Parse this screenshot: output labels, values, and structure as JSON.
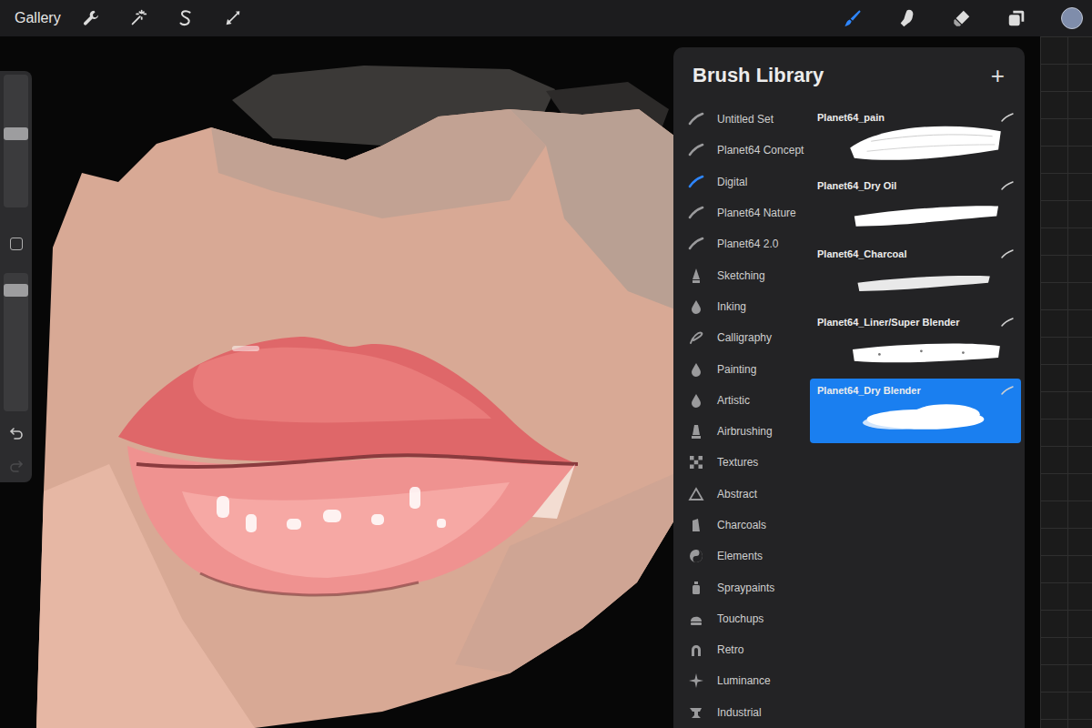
{
  "toolbar": {
    "gallery": "Gallery",
    "actions": [
      {
        "kind": "wrench"
      },
      {
        "kind": "wand"
      },
      {
        "kind": "selection"
      },
      {
        "kind": "transform"
      }
    ],
    "tools": [
      {
        "kind": "brush",
        "selected": true
      },
      {
        "kind": "smudge",
        "selected": false
      },
      {
        "kind": "eraser",
        "selected": false
      },
      {
        "kind": "layers",
        "selected": false
      }
    ],
    "color": "#7f8dab"
  },
  "sidebar": {
    "size_level": 0.56,
    "opacity_level": 0.91
  },
  "brush_library": {
    "title": "Brush Library",
    "add": "+",
    "sets": [
      {
        "label": "Untitled Set",
        "kind": "stroke",
        "selected": false
      },
      {
        "label": "Planet64 Concept",
        "kind": "stroke",
        "selected": false
      },
      {
        "label": "Digital",
        "kind": "stroke",
        "selected": true
      },
      {
        "label": "Planet64 Nature",
        "kind": "stroke",
        "selected": false
      },
      {
        "label": "Planet64 2.0",
        "kind": "stroke",
        "selected": false
      },
      {
        "label": "Sketching",
        "kind": "pencil",
        "selected": false
      },
      {
        "label": "Inking",
        "kind": "drop",
        "selected": false
      },
      {
        "label": "Calligraphy",
        "kind": "curl",
        "selected": false
      },
      {
        "label": "Painting",
        "kind": "drop",
        "selected": false
      },
      {
        "label": "Artistic",
        "kind": "drop",
        "selected": false
      },
      {
        "label": "Airbrushing",
        "kind": "airbrush",
        "selected": false
      },
      {
        "label": "Textures",
        "kind": "checker",
        "selected": false
      },
      {
        "label": "Abstract",
        "kind": "triangle",
        "selected": false
      },
      {
        "label": "Charcoals",
        "kind": "charcoal",
        "selected": false
      },
      {
        "label": "Elements",
        "kind": "yin",
        "selected": false
      },
      {
        "label": "Spraypaints",
        "kind": "spray",
        "selected": false
      },
      {
        "label": "Touchups",
        "kind": "bell",
        "selected": false
      },
      {
        "label": "Retro",
        "kind": "arch",
        "selected": false
      },
      {
        "label": "Luminance",
        "kind": "star",
        "selected": false
      },
      {
        "label": "Industrial",
        "kind": "anvil",
        "selected": false
      }
    ],
    "brushes": [
      {
        "name": "Planet64_pain",
        "kind": "paint",
        "selected": false
      },
      {
        "name": "Planet64_Dry Oil",
        "kind": "dry-oil",
        "selected": false
      },
      {
        "name": "Planet64_Charcoal",
        "kind": "charcoal",
        "selected": false
      },
      {
        "name": "Planet64_Liner/Super Blender",
        "kind": "liner",
        "selected": false
      },
      {
        "name": "Planet64_Dry Blender",
        "kind": "dry-blender",
        "selected": true
      }
    ]
  }
}
